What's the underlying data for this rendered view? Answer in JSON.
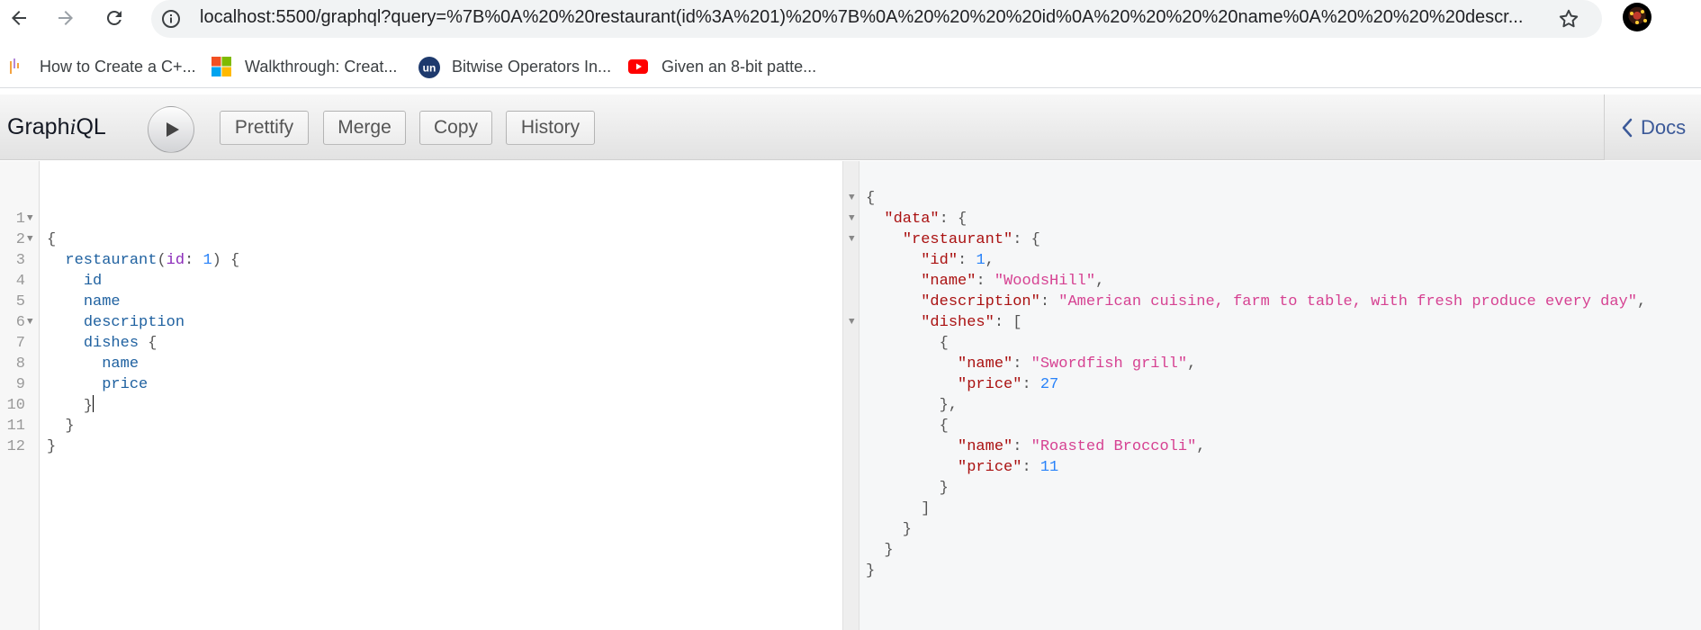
{
  "browser": {
    "url": "localhost:5500/graphql?query=%7B%0A%20%20restaurant(id%3A%201)%20%7B%0A%20%20%20%20id%0A%20%20%20%20name%0A%20%20%20%20descr..."
  },
  "bookmarks": [
    {
      "label": "How to Create a C+...",
      "icon": "bar-chart-icon"
    },
    {
      "label": "Walkthrough: Creat...",
      "icon": "microsoft-logo-icon"
    },
    {
      "label": "Bitwise Operators In...",
      "icon": "un-logo-icon"
    },
    {
      "label": "Given an 8-bit patte...",
      "icon": "youtube-icon"
    }
  ],
  "toolbar": {
    "title_prefix": "Graph",
    "title_italic": "i",
    "title_suffix": "QL",
    "prettify": "Prettify",
    "merge": "Merge",
    "copy": "Copy",
    "history": "History",
    "docs": "Docs"
  },
  "query": {
    "line_numbers": [
      "1",
      "2",
      "3",
      "4",
      "5",
      "6",
      "7",
      "8",
      "9",
      "10",
      "11",
      "12"
    ],
    "l1": "{",
    "l2_field": "restaurant",
    "l2_open": "(",
    "l2_arg": "id",
    "l2_colon": ": ",
    "l2_num": "1",
    "l2_close": ") {",
    "l3": "id",
    "l4": "name",
    "l5": "description",
    "l6_field": "dishes",
    "l6_brace": " {",
    "l7": "name",
    "l8": "price",
    "l9": "}",
    "l10": "}",
    "l11": "}"
  },
  "result": {
    "r1": "{",
    "k_data": "\"data\"",
    "k_restaurant": "\"restaurant\"",
    "k_id": "\"id\"",
    "v_id": "1",
    "k_name": "\"name\"",
    "v_name": "\"WoodsHill\"",
    "k_description": "\"description\"",
    "v_description": "\"American cuisine, farm to table, with fresh produce every day\"",
    "k_dishes": "\"dishes\"",
    "k_dish_name": "\"name\"",
    "k_dish_price": "\"price\"",
    "dish1_name": "\"Swordfish grill\"",
    "dish1_price": "27",
    "dish2_name": "\"Roasted Broccoli\"",
    "dish2_price": "11"
  }
}
